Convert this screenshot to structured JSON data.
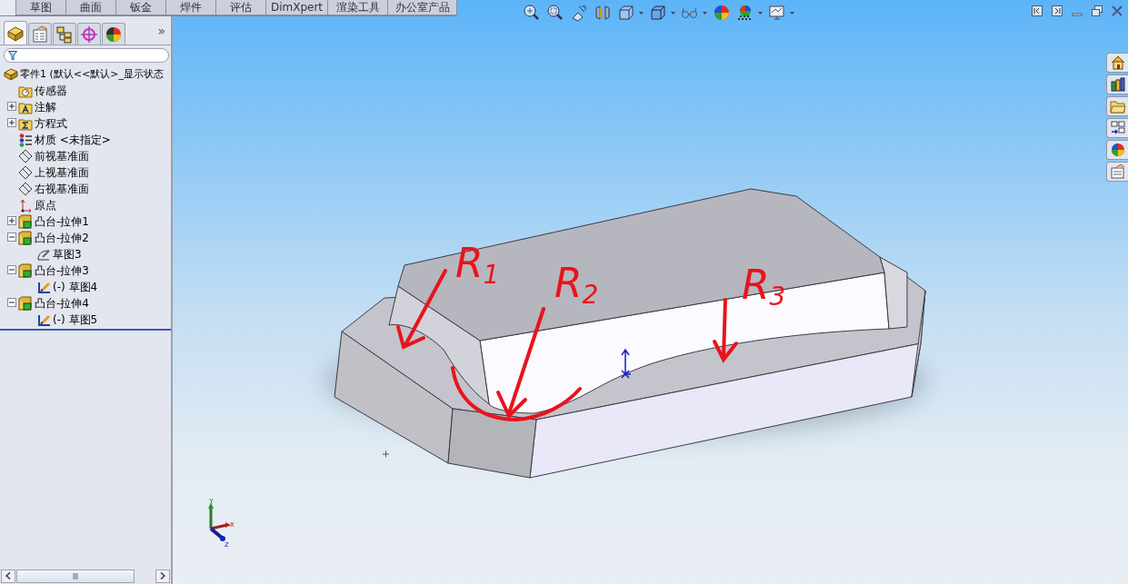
{
  "tabs": [
    {
      "label": "草图",
      "selected": false
    },
    {
      "label": "曲面",
      "selected": false
    },
    {
      "label": "钣金",
      "selected": false
    },
    {
      "label": "焊件",
      "selected": false
    },
    {
      "label": "评估",
      "selected": false
    },
    {
      "label": "DimXpert",
      "selected": false
    },
    {
      "label": "渲染工具",
      "selected": false
    },
    {
      "label": "办公室产品",
      "selected": false
    }
  ],
  "panel_tabs": [
    {
      "kind": "part",
      "selected": true
    },
    {
      "kind": "properties",
      "selected": false
    },
    {
      "kind": "configurations",
      "selected": false
    },
    {
      "kind": "target",
      "selected": false
    },
    {
      "kind": "appearance",
      "selected": false
    }
  ],
  "panel_more": "»",
  "tree": {
    "label": "零件1 (默认<<默认>_显示状态",
    "kind": "part",
    "children": [
      {
        "label": "传感器",
        "kind": "sensor-folder"
      },
      {
        "label": "注解",
        "kind": "annotation-folder",
        "expanded": false
      },
      {
        "label": "方程式",
        "kind": "equation-folder",
        "expanded": false
      },
      {
        "label": "材质 <未指定>",
        "kind": "material"
      },
      {
        "label": "前视基准面",
        "kind": "plane"
      },
      {
        "label": "上视基准面",
        "kind": "plane"
      },
      {
        "label": "右视基准面",
        "kind": "plane"
      },
      {
        "label": "原点",
        "kind": "origin"
      },
      {
        "label": "凸台-拉伸1",
        "kind": "feature",
        "expanded": false
      },
      {
        "label": "凸台-拉伸2",
        "kind": "feature",
        "expanded": true,
        "children": [
          {
            "label": "草图3",
            "kind": "sketch"
          }
        ]
      },
      {
        "label": "凸台-拉伸3",
        "kind": "feature",
        "expanded": true,
        "children": [
          {
            "label": "(-) 草图4",
            "kind": "sketch-open"
          }
        ]
      },
      {
        "label": "凸台-拉伸4",
        "kind": "feature",
        "expanded": true,
        "children": [
          {
            "label": "(-) 草图5",
            "kind": "sketch-open"
          }
        ]
      }
    ]
  },
  "annotations": [
    "R$_{1}$",
    "R$_{2}$",
    "R$_{3}$"
  ],
  "triad": {
    "y": "Y",
    "x": "X",
    "z": "Z"
  }
}
